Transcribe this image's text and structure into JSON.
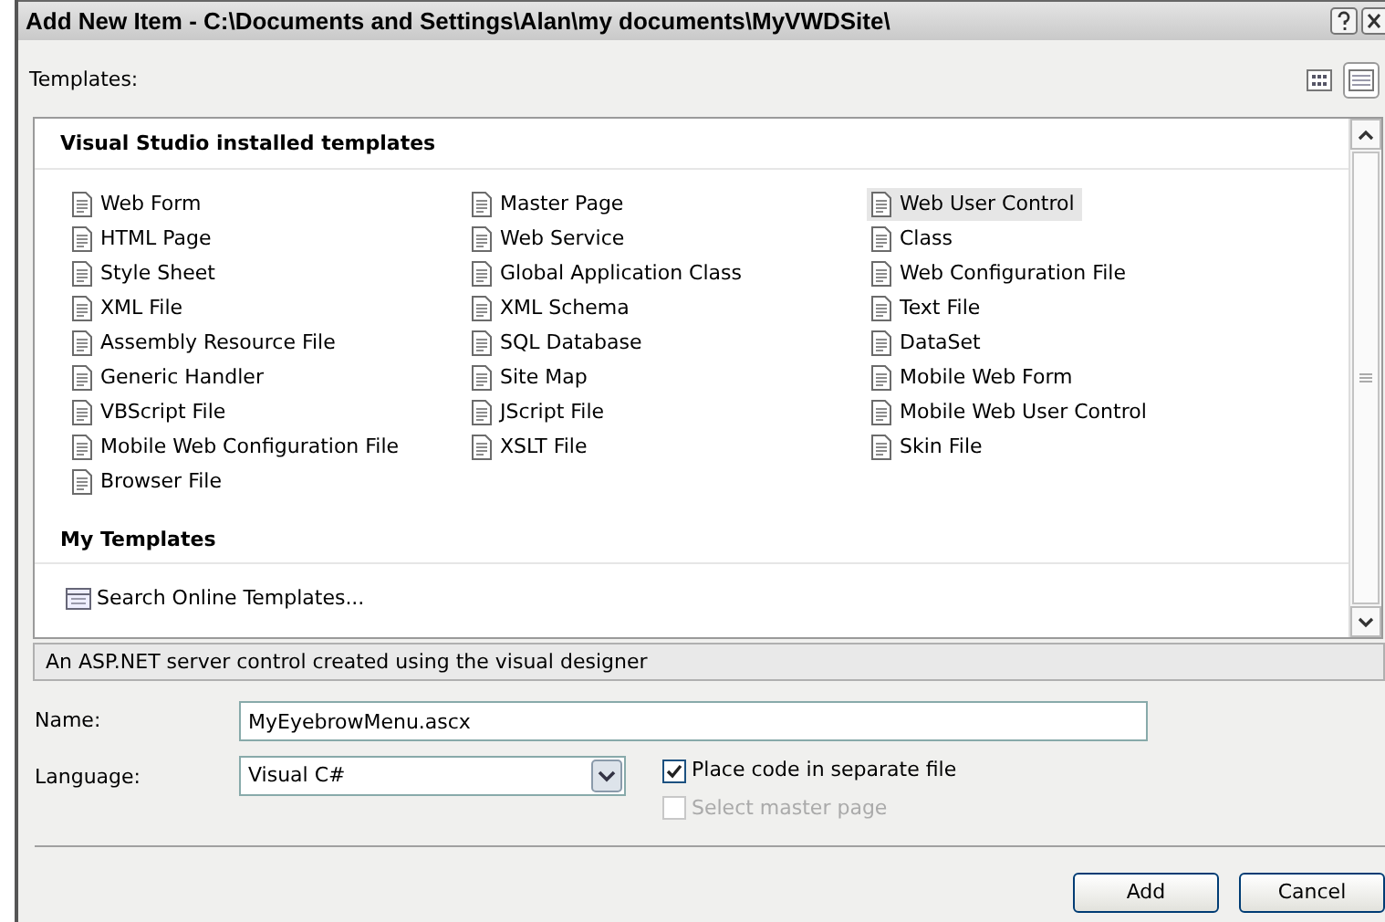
{
  "window": {
    "title": "Add New Item - C:\\Documents and Settings\\Alan\\my documents\\MyVWDSite\\"
  },
  "templates_label": "Templates:",
  "views": [
    {
      "kind": "large",
      "selected": false
    },
    {
      "kind": "small",
      "selected": true
    }
  ],
  "installed": {
    "heading": "Visual Studio installed templates",
    "columns": [
      [
        {
          "label": "Web Form",
          "selected": false
        },
        {
          "label": "HTML Page",
          "selected": false
        },
        {
          "label": "Style Sheet",
          "selected": false
        },
        {
          "label": "XML File",
          "selected": false
        },
        {
          "label": "Assembly Resource File",
          "selected": false
        },
        {
          "label": "Generic Handler",
          "selected": false
        },
        {
          "label": "VBScript File",
          "selected": false
        },
        {
          "label": "Mobile Web Configuration File",
          "selected": false
        },
        {
          "label": "Browser File",
          "selected": false
        }
      ],
      [
        {
          "label": "Master Page",
          "selected": false
        },
        {
          "label": "Web Service",
          "selected": false
        },
        {
          "label": "Global Application Class",
          "selected": false
        },
        {
          "label": "XML Schema",
          "selected": false
        },
        {
          "label": "SQL Database",
          "selected": false
        },
        {
          "label": "Site Map",
          "selected": false
        },
        {
          "label": "JScript File",
          "selected": false
        },
        {
          "label": "XSLT File",
          "selected": false
        }
      ],
      [
        {
          "label": "Web User Control",
          "selected": true
        },
        {
          "label": "Class",
          "selected": false
        },
        {
          "label": "Web Configuration File",
          "selected": false
        },
        {
          "label": "Text File",
          "selected": false
        },
        {
          "label": "DataSet",
          "selected": false
        },
        {
          "label": "Mobile Web Form",
          "selected": false
        },
        {
          "label": "Mobile Web User Control",
          "selected": false
        },
        {
          "label": "Skin File",
          "selected": false
        }
      ]
    ]
  },
  "my_templates": {
    "heading": "My Templates",
    "items": [
      {
        "label": "Search Online Templates...",
        "selected": false
      }
    ]
  },
  "description": "An ASP.NET server control created using the visual designer",
  "name_field": {
    "label": "Name:",
    "value": "MyEyebrowMenu.ascx"
  },
  "language_field": {
    "label": "Language:",
    "value": "Visual C#"
  },
  "options": [
    {
      "label": "Place code in separate file",
      "checked": true,
      "disabled": false
    },
    {
      "label": "Select master page",
      "checked": false,
      "disabled": true
    }
  ],
  "buttons": [
    "Add",
    "Cancel"
  ]
}
